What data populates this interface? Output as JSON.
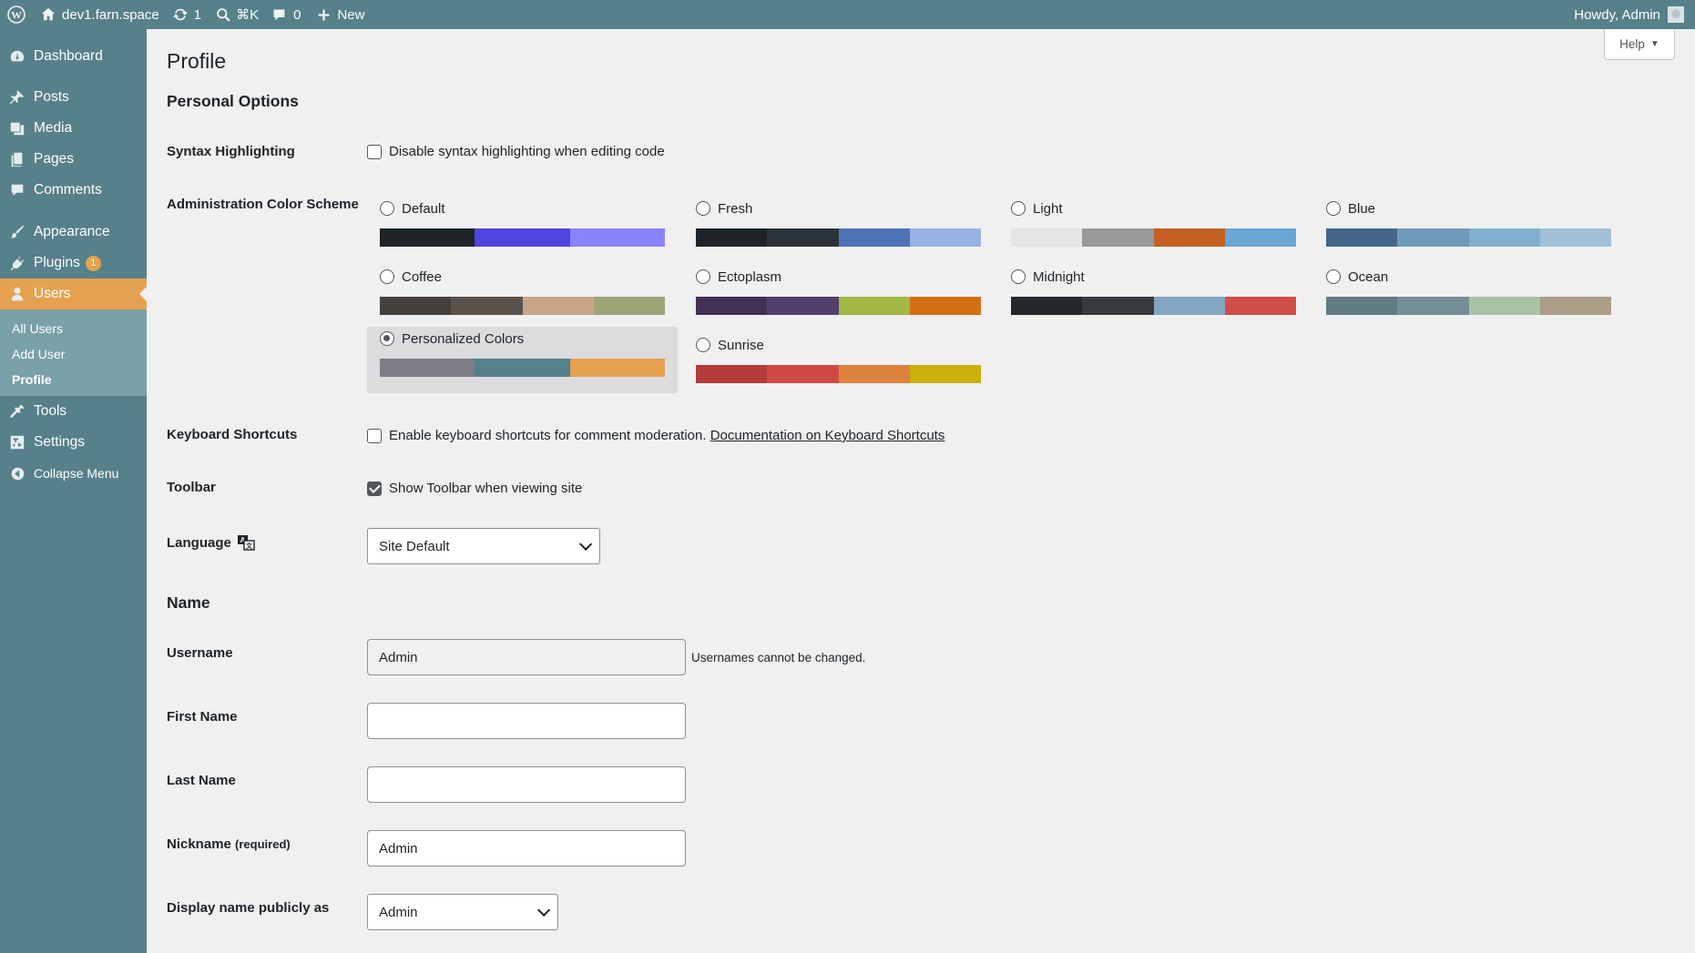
{
  "adminbar": {
    "site_name": "dev1.farn.space",
    "updates_count": "1",
    "search_shortcut": "⌘K",
    "comments_count": "0",
    "new_label": "New",
    "howdy": "Howdy, Admin"
  },
  "menu": {
    "items": [
      {
        "label": "Dashboard",
        "icon": "dashboard-icon"
      },
      {
        "label": "Posts",
        "icon": "pin-icon"
      },
      {
        "label": "Media",
        "icon": "media-icon"
      },
      {
        "label": "Pages",
        "icon": "pages-icon"
      },
      {
        "label": "Comments",
        "icon": "comment-icon"
      },
      {
        "label": "Appearance",
        "icon": "brush-icon"
      },
      {
        "label": "Plugins",
        "icon": "plugin-icon",
        "badge": "1"
      },
      {
        "label": "Users",
        "icon": "user-icon",
        "current": true
      },
      {
        "label": "Tools",
        "icon": "wrench-icon"
      },
      {
        "label": "Settings",
        "icon": "settings-icon"
      },
      {
        "label": "Collapse Menu",
        "icon": "collapse-icon"
      }
    ],
    "users_submenu": [
      "All Users",
      "Add User",
      "Profile"
    ]
  },
  "page": {
    "title": "Profile",
    "help_label": "Help",
    "personal_options_heading": "Personal Options",
    "syntax": {
      "label": "Syntax Highlighting",
      "checkbox_text": "Disable syntax highlighting when editing code",
      "checked": false
    },
    "color_scheme": {
      "label": "Administration Color Scheme",
      "schemes": [
        {
          "name": "Default",
          "colors": [
            "#1d2327",
            "#4f44e0",
            "#8a83ff"
          ]
        },
        {
          "name": "Fresh",
          "colors": [
            "#1d2327",
            "#2c3338",
            "#4e73b8",
            "#99b2e6"
          ]
        },
        {
          "name": "Light",
          "colors": [
            "#e5e5e5",
            "#999999",
            "#c55f23",
            "#6aa6d4"
          ]
        },
        {
          "name": "Blue",
          "colors": [
            "#446689",
            "#6e9ab8",
            "#82afd1",
            "#a0c1d8"
          ]
        },
        {
          "name": "Coffee",
          "colors": [
            "#46403c",
            "#59524c",
            "#c7a589",
            "#9ea476"
          ]
        },
        {
          "name": "Ectoplasm",
          "colors": [
            "#413256",
            "#523f6d",
            "#a3b745",
            "#d46f15"
          ]
        },
        {
          "name": "Midnight",
          "colors": [
            "#25282b",
            "#363b3f",
            "#83a6c1",
            "#d04d49"
          ]
        },
        {
          "name": "Ocean",
          "colors": [
            "#627c83",
            "#738e96",
            "#a8c2a6",
            "#ab9d86"
          ]
        },
        {
          "name": "Personalized Colors",
          "colors": [
            "#7c7d84",
            "#56808a",
            "#e5a14f"
          ],
          "selected": true
        },
        {
          "name": "Sunrise",
          "colors": [
            "#b43c38",
            "#cf4944",
            "#dd823b",
            "#ccaf0b"
          ]
        }
      ]
    },
    "keyboard": {
      "label": "Keyboard Shortcuts",
      "checkbox_text": "Enable keyboard shortcuts for comment moderation.",
      "link_text": "Documentation on Keyboard Shortcuts",
      "checked": false
    },
    "toolbar": {
      "label": "Toolbar",
      "checkbox_text": "Show Toolbar when viewing site",
      "checked": true
    },
    "language": {
      "label": "Language",
      "value": "Site Default"
    },
    "name_heading": "Name",
    "username": {
      "label": "Username",
      "value": "Admin",
      "description": "Usernames cannot be changed."
    },
    "first_name": {
      "label": "First Name",
      "value": ""
    },
    "last_name": {
      "label": "Last Name",
      "value": ""
    },
    "nickname": {
      "label": "Nickname",
      "required": "(required)",
      "value": "Admin"
    },
    "display_name": {
      "label": "Display name publicly as",
      "value": "Admin"
    }
  }
}
